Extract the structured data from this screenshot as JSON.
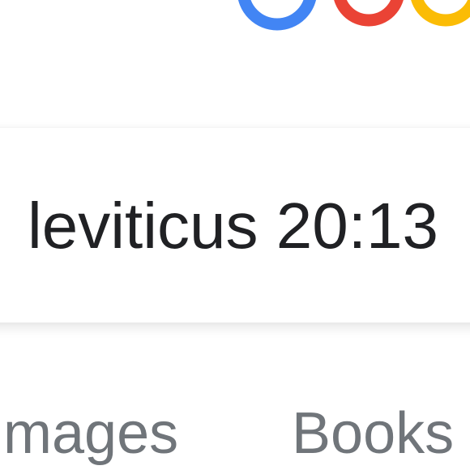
{
  "logo": {
    "name": "google-logo",
    "colors": [
      "#4285f4",
      "#ea4335",
      "#fbbc05"
    ]
  },
  "search": {
    "query": "leviticus 20:13"
  },
  "tabs": [
    {
      "label": "Images"
    },
    {
      "label": "Books"
    }
  ],
  "colors": {
    "text": "#202124",
    "tab_text": "#70757a"
  }
}
